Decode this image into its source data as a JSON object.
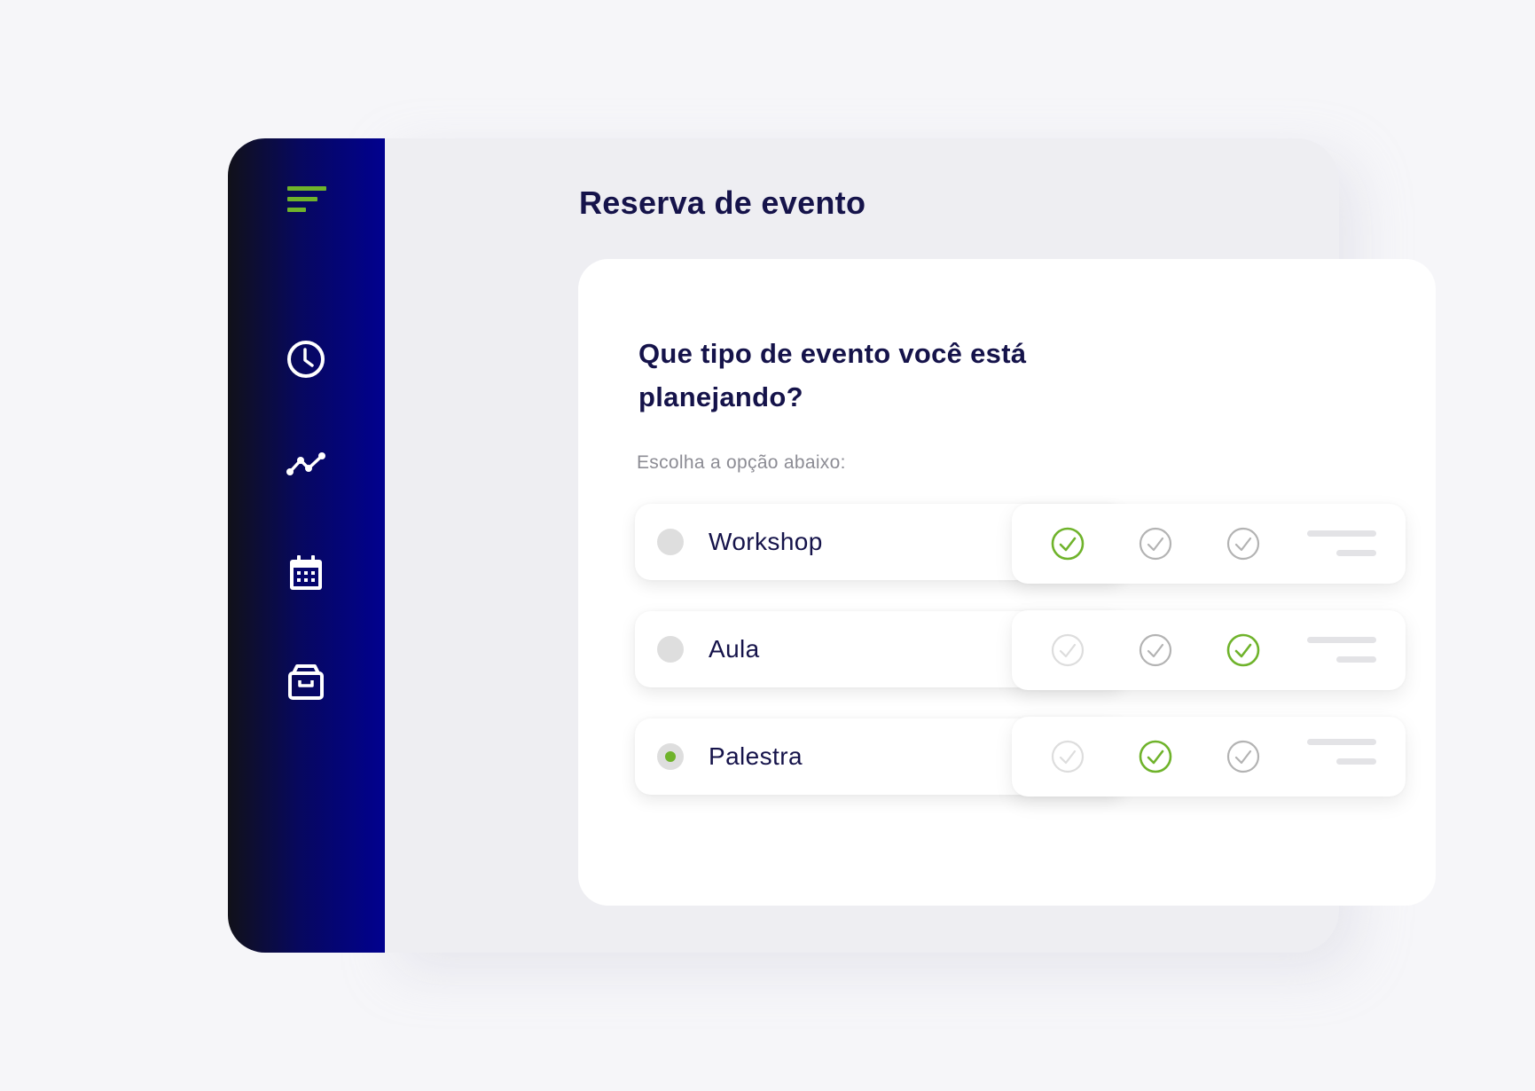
{
  "sidebar": {
    "logo": "menu-lines-logo",
    "items": [
      {
        "name": "history",
        "icon": "clock-icon"
      },
      {
        "name": "analytics",
        "icon": "trend-line-icon"
      },
      {
        "name": "calendar",
        "icon": "calendar-icon"
      },
      {
        "name": "archive",
        "icon": "archive-box-icon"
      }
    ]
  },
  "header": {
    "title": "Reserva de evento"
  },
  "form": {
    "question": "Que tipo de evento você está planejando?",
    "hint": "Escolha a opção abaixo:",
    "selected": "Palestra",
    "options": [
      {
        "label": "Workshop",
        "selected": false,
        "checks": [
          "active",
          "neutral",
          "neutral"
        ]
      },
      {
        "label": "Aula",
        "selected": false,
        "checks": [
          "faded",
          "neutral",
          "active"
        ]
      },
      {
        "label": "Palestra",
        "selected": true,
        "checks": [
          "faded",
          "active",
          "neutral"
        ]
      }
    ]
  },
  "colors": {
    "accent_green": "#6fb32b",
    "heading_navy": "#15134a",
    "sidebar_blue": "#01018f",
    "check_neutral": "#b3b3b3",
    "check_faded": "#dddddd"
  }
}
